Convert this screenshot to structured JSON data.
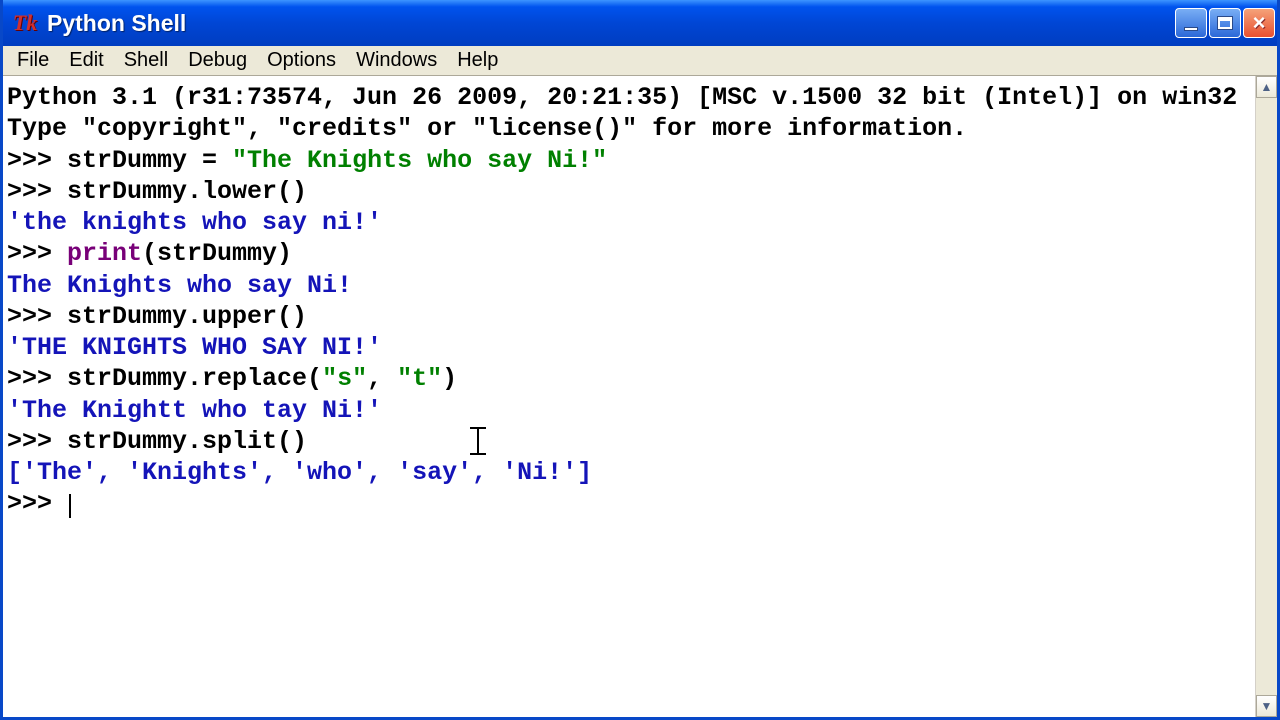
{
  "window": {
    "title": "Python Shell",
    "icon_glyph": "Tk"
  },
  "menu": {
    "items": [
      "File",
      "Edit",
      "Shell",
      "Debug",
      "Options",
      "Windows",
      "Help"
    ]
  },
  "terminal": {
    "banner_line1": "Python 3.1 (r31:73574, Jun 26 2009, 20:21:35) [MSC v.1500 32 bit (Intel)] on win32",
    "banner_line2": "Type \"copyright\", \"credits\" or \"license()\" for more information.",
    "lines": [
      {
        "type": "input",
        "parts": [
          {
            "text": "strDummy = ",
            "cls": "c-black"
          },
          {
            "text": "\"The Knights who say Ni!\"",
            "cls": "c-green"
          }
        ]
      },
      {
        "type": "input",
        "parts": [
          {
            "text": "strDummy.lower()",
            "cls": "c-black"
          }
        ]
      },
      {
        "type": "output",
        "parts": [
          {
            "text": "'the knights who say ni!'",
            "cls": "c-blue"
          }
        ]
      },
      {
        "type": "input",
        "parts": [
          {
            "text": "print",
            "cls": "c-purple"
          },
          {
            "text": "(strDummy)",
            "cls": "c-black"
          }
        ]
      },
      {
        "type": "output",
        "parts": [
          {
            "text": "The Knights who say Ni!",
            "cls": "c-blue"
          }
        ]
      },
      {
        "type": "input",
        "parts": [
          {
            "text": "strDummy.upper()",
            "cls": "c-black"
          }
        ]
      },
      {
        "type": "output",
        "parts": [
          {
            "text": "'THE KNIGHTS WHO SAY NI!'",
            "cls": "c-blue"
          }
        ]
      },
      {
        "type": "input",
        "parts": [
          {
            "text": "strDummy.replace(",
            "cls": "c-black"
          },
          {
            "text": "\"s\"",
            "cls": "c-green"
          },
          {
            "text": ", ",
            "cls": "c-black"
          },
          {
            "text": "\"t\"",
            "cls": "c-green"
          },
          {
            "text": ")",
            "cls": "c-black"
          }
        ]
      },
      {
        "type": "output",
        "parts": [
          {
            "text": "'The Knightt who tay Ni!'",
            "cls": "c-blue"
          }
        ]
      },
      {
        "type": "input",
        "parts": [
          {
            "text": "strDummy.split()",
            "cls": "c-black"
          }
        ],
        "caret_after": true
      },
      {
        "type": "output",
        "parts": [
          {
            "text": "['The', 'Knights', 'who', 'say', 'Ni!']",
            "cls": "c-blue"
          }
        ]
      },
      {
        "type": "input",
        "parts": [],
        "cursor": true
      }
    ]
  }
}
